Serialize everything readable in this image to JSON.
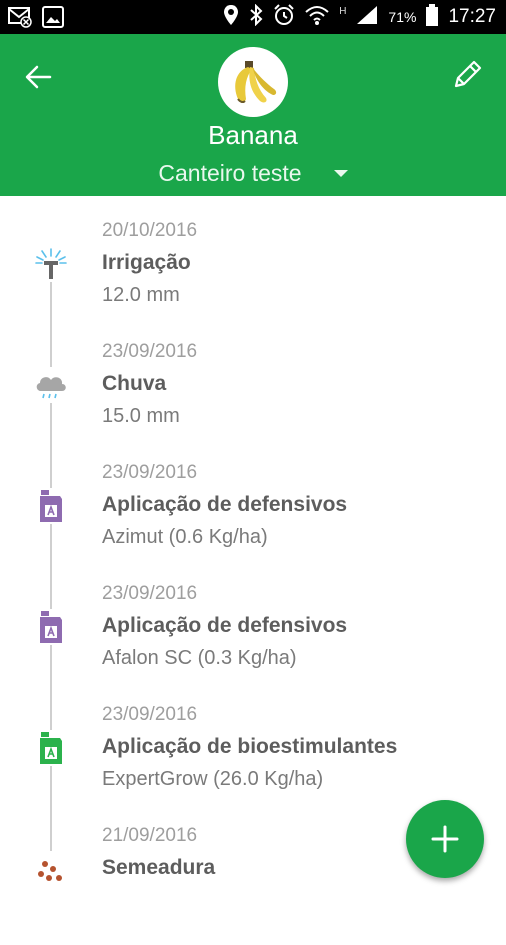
{
  "status_bar": {
    "battery_percent": "71%",
    "network_type": "H",
    "time": "17:27",
    "icons": [
      "missed-email-icon",
      "image-icon",
      "location-icon",
      "bluetooth-icon",
      "alarm-icon",
      "wifi-icon",
      "signal-icon",
      "battery-icon"
    ]
  },
  "header": {
    "background_color": "#1aa64a",
    "crop_name": "Banana",
    "plot_name": "Canteiro teste",
    "icons": [
      "arrow-back-icon",
      "pencil-icon",
      "banana-icon",
      "dropdown-caret-icon"
    ]
  },
  "timeline": {
    "events": [
      {
        "date": "20/10/2016",
        "title": "Irrigação",
        "detail": "12.0 mm",
        "icon": "sprinkler-icon"
      },
      {
        "date": "23/09/2016",
        "title": "Chuva",
        "detail": "15.0 mm",
        "icon": "rain-cloud-icon"
      },
      {
        "date": "23/09/2016",
        "title": "Aplicação de defensivos",
        "detail": "Azimut (0.6 Kg/ha)",
        "icon": "pesticide-jug-icon",
        "icon_color": "#8e6bb0"
      },
      {
        "date": "23/09/2016",
        "title": "Aplicação de defensivos",
        "detail": "Afalon SC (0.3 Kg/ha)",
        "icon": "pesticide-jug-icon",
        "icon_color": "#8e6bb0"
      },
      {
        "date": "23/09/2016",
        "title": "Aplicação de bioestimulantes",
        "detail": "ExpertGrow (26.0 Kg/ha)",
        "icon": "biostimulant-jug-icon",
        "icon_color": "#2bb24c"
      },
      {
        "date": "21/09/2016",
        "title": "Semeadura",
        "detail": "",
        "icon": "seeds-icon",
        "icon_color": "#b5532f"
      }
    ]
  },
  "fab": {
    "icon": "plus-icon",
    "color": "#1aa64a"
  }
}
